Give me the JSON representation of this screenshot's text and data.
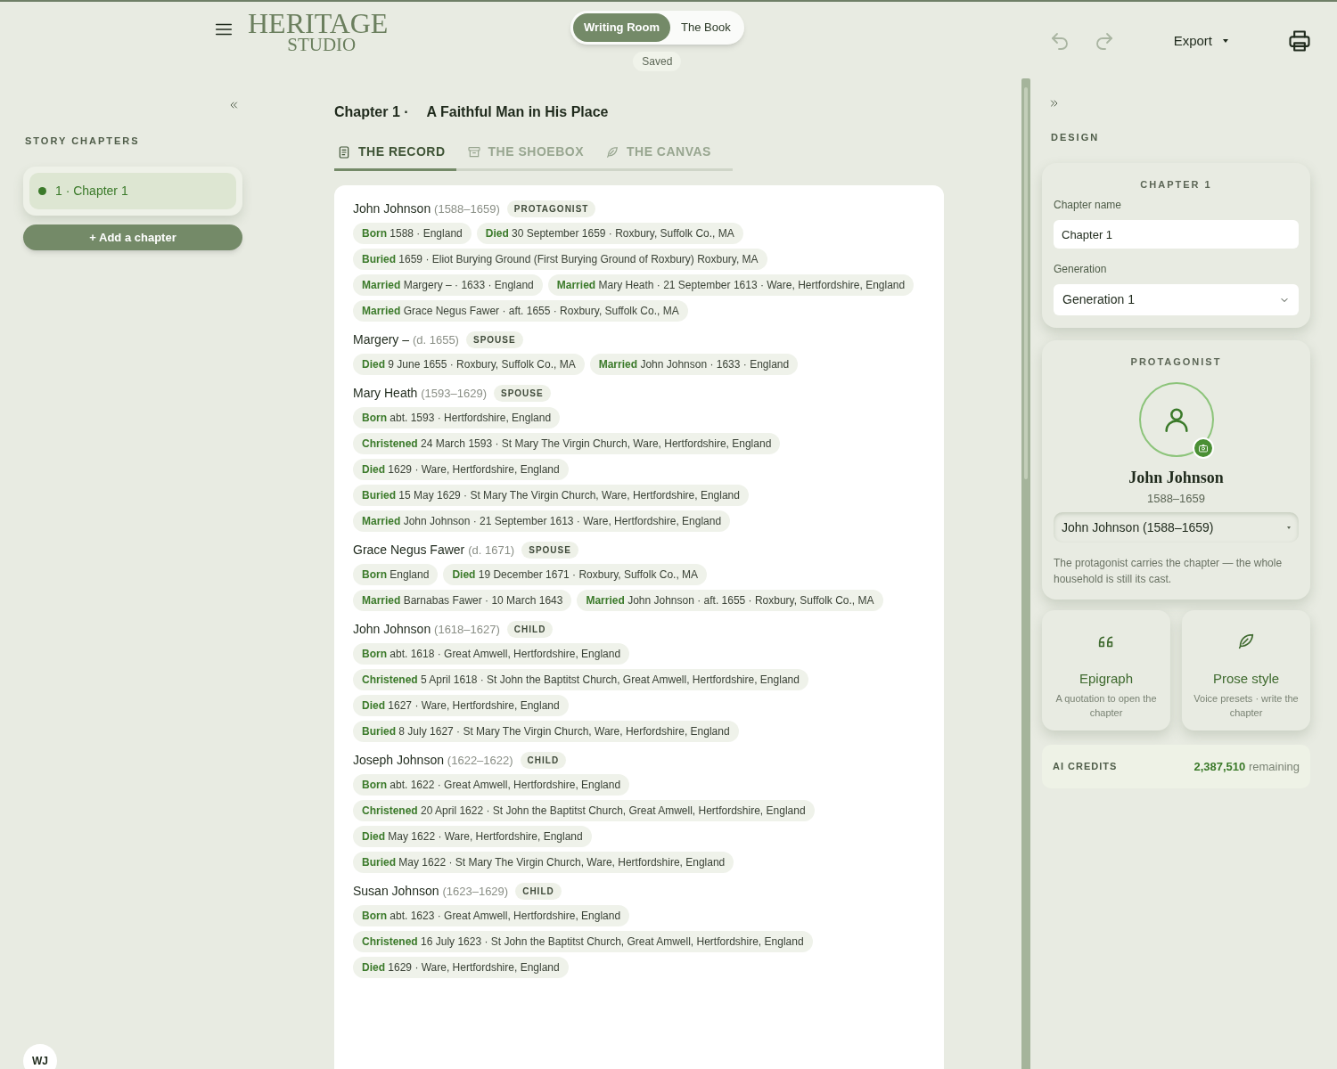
{
  "header": {
    "logo_top": "HERITAGE",
    "logo_bottom": "STUDIO",
    "mode_switch": [
      {
        "label": "Writing Room",
        "selected": true
      },
      {
        "label": "The Book",
        "selected": false
      }
    ],
    "save_status": "Saved",
    "export": "Export"
  },
  "sidebar": {
    "title": "STORY CHAPTERS",
    "chapters": [
      {
        "label": "1 · Chapter 1",
        "selected": true
      }
    ],
    "add_button": "+ Add a chapter",
    "user_initials": "WJ"
  },
  "chapter": {
    "number": "Chapter 1 ·",
    "title": "A Faithful Man in His Place"
  },
  "tabs": [
    {
      "label": "THE RECORD",
      "selected": true
    },
    {
      "label": "THE SHOEBOX",
      "selected": false
    },
    {
      "label": "THE CANVAS",
      "selected": false
    }
  ],
  "people": [
    {
      "name": "John Johnson",
      "dates": "(1588–1659)",
      "role": "PROTAGONIST",
      "events": [
        {
          "label": "Born",
          "text": "1588 · England"
        },
        {
          "label": "Died",
          "text": "30 September 1659 · Roxbury, Suffolk Co., MA"
        },
        {
          "label": "Buried",
          "text": "1659 · Eliot Burying Ground (First Burying Ground of Roxbury) Roxbury, MA"
        },
        {
          "label": "Married",
          "text": "Margery – · 1633 · England"
        },
        {
          "label": "Married",
          "text": "Mary Heath · 21 September 1613 · Ware, Hertfordshire, England"
        },
        {
          "label": "Married",
          "text": "Grace Negus Fawer · aft. 1655 · Roxbury, Suffolk Co., MA"
        }
      ]
    },
    {
      "name": "Margery –",
      "dates": "(d. 1655)",
      "role": "SPOUSE",
      "events": [
        {
          "label": "Died",
          "text": "9 June 1655 · Roxbury, Suffolk Co., MA"
        },
        {
          "label": "Married",
          "text": "John Johnson · 1633 · England"
        }
      ]
    },
    {
      "name": "Mary Heath",
      "dates": "(1593–1629)",
      "role": "SPOUSE",
      "events": [
        {
          "label": "Born",
          "text": "abt. 1593 · Hertfordshire, England"
        },
        {
          "label": "Christened",
          "text": "24 March 1593 · St Mary The Virgin Church, Ware, Hertfordshire, England"
        },
        {
          "label": "Died",
          "text": "1629 · Ware, Hertfordshire, England"
        },
        {
          "label": "Buried",
          "text": "15 May 1629 · St Mary The Virgin Church, Ware, Hertfordshire, England"
        },
        {
          "label": "Married",
          "text": "John Johnson · 21 September 1613 · Ware, Hertfordshire, England"
        }
      ]
    },
    {
      "name": "Grace Negus Fawer",
      "dates": "(d. 1671)",
      "role": "SPOUSE",
      "events": [
        {
          "label": "Born",
          "text": "England"
        },
        {
          "label": "Died",
          "text": "19 December 1671 · Roxbury, Suffolk Co., MA"
        },
        {
          "label": "Married",
          "text": "Barnabas Fawer · 10 March 1643"
        },
        {
          "label": "Married",
          "text": "John Johnson · aft. 1655 · Roxbury, Suffolk Co., MA"
        }
      ]
    },
    {
      "name": "John Johnson",
      "dates": "(1618–1627)",
      "role": "CHILD",
      "events": [
        {
          "label": "Born",
          "text": "abt. 1618 · Great Amwell, Hertfordshire, England"
        },
        {
          "label": "Christened",
          "text": "5 April 1618 · St John the Baptitst Church, Great Amwell, Hertfordshire, England"
        },
        {
          "label": "Died",
          "text": "1627 · Ware, Hertfordshire, England"
        },
        {
          "label": "Buried",
          "text": "8 July 1627 · St Mary The Virgin Church, Ware, Herfordshire, England"
        }
      ]
    },
    {
      "name": "Joseph Johnson",
      "dates": "(1622–1622)",
      "role": "CHILD",
      "events": [
        {
          "label": "Born",
          "text": "abt. 1622 · Great Amwell, Hertfordshire, England"
        },
        {
          "label": "Christened",
          "text": "20 April 1622 · St John the Baptitst Church, Great Amwell, Hertfordshire, England"
        },
        {
          "label": "Died",
          "text": "May 1622 · Ware, Hertfordshire, England"
        },
        {
          "label": "Buried",
          "text": "May 1622 · St Mary The Virgin Church, Ware, Hertfordshire, England"
        }
      ]
    },
    {
      "name": "Susan Johnson",
      "dates": "(1623–1629)",
      "role": "CHILD",
      "events": [
        {
          "label": "Born",
          "text": "abt. 1623 · Great Amwell, Hertfordshire, England"
        },
        {
          "label": "Christened",
          "text": "16 July 1623 · St John the Baptitst Church, Great Amwell, Hertfordshire, England"
        },
        {
          "label": "Died",
          "text": "1629 · Ware, Hertfordshire, England"
        }
      ]
    }
  ],
  "design_panel": {
    "title": "DESIGN",
    "chapter_card": {
      "heading": "CHAPTER 1",
      "name_label": "Chapter name",
      "name_value": "Chapter 1",
      "generation_label": "Generation",
      "generation_value": "Generation 1"
    },
    "protagonist_card": {
      "heading": "PROTAGONIST",
      "name": "John Johnson",
      "dates": "1588–1659",
      "select_value": "John Johnson (1588–1659)",
      "note": "The protagonist carries the chapter — the whole household is still its cast."
    },
    "tools": [
      {
        "title": "Epigraph",
        "description": "A quotation to open the chapter"
      },
      {
        "title": "Prose style",
        "description": "Voice presets · write the chapter"
      }
    ],
    "credits": {
      "label": "AI CREDITS",
      "amount": "2,387,510",
      "suffix": "remaining"
    }
  }
}
